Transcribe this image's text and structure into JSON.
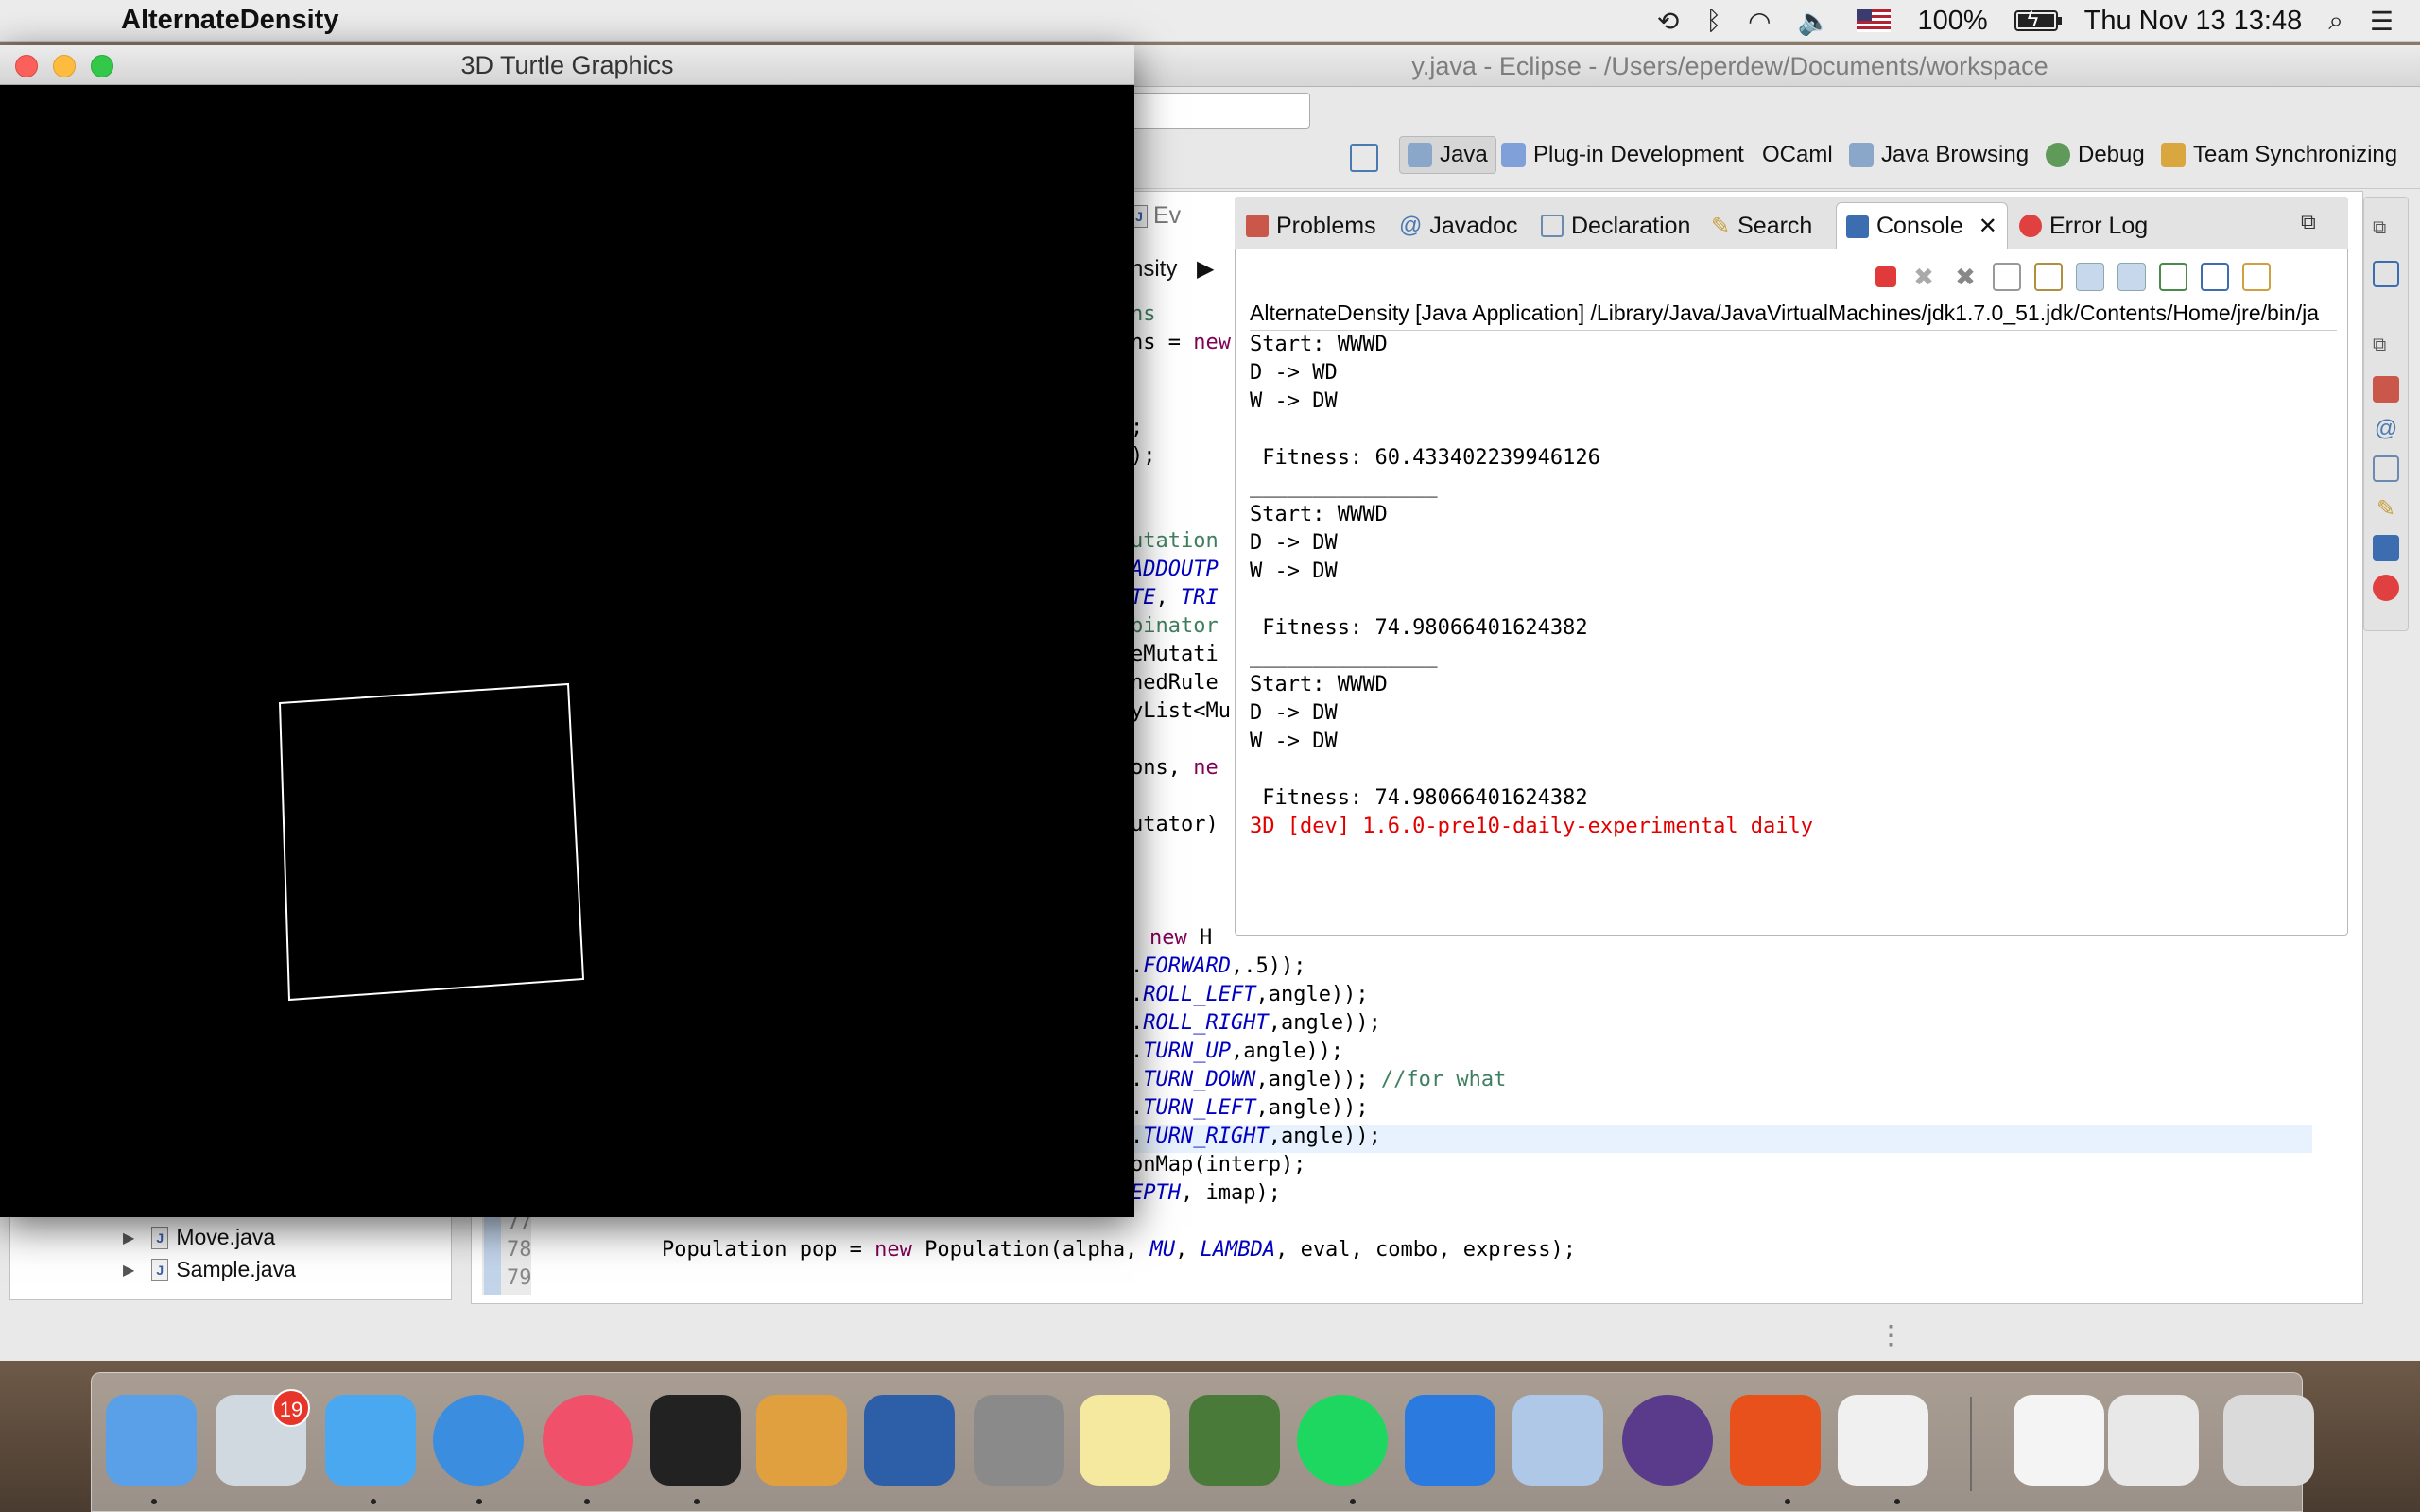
{
  "menubar": {
    "apple_glyph": "",
    "app_name": "AlternateDensity",
    "battery_pct": "100%",
    "battery_level": 1.0,
    "clock": "Thu Nov 13  13:48"
  },
  "eclipse": {
    "title": "y.java - Eclipse - /Users/eperdew/Documents/workspace",
    "perspectives": [
      "Java",
      "Plug-in Development",
      "OCaml",
      "Java Browsing",
      "Debug",
      "Team Synchronizing"
    ],
    "editor_tab_fragment": "Ev",
    "breadcrumb_fragment": "nsity",
    "code": {
      "l1": "ns",
      "l2": "ns = ",
      "l2_kw": "new",
      "l3": ";",
      "l4": ");",
      "l5": "utation",
      "l6": "ADDOUTP",
      "l7a": "TE",
      "l7b": ", ",
      "l7c": "TRI",
      "l8": "binator",
      "l9": "eMutati",
      "l10": "nedRule",
      "l11": "yList<Mu",
      "l12": "ons, ",
      "l12_kw": "ne",
      "l13": "utator)",
      "l14_kw": "new",
      "l14": " H",
      "l15a": ".",
      "l15b": "FORWARD",
      "l15c": ",.5));",
      "l16b": "ROLL_LEFT",
      "l16c": ",angle));",
      "l17b": "ROLL_RIGHT",
      "l17c": ",angle));",
      "l18b": "TURN_UP",
      "l18c": ",angle));",
      "l19b": "TURN_DOWN",
      "l19c": ",angle)); ",
      "l19d": "//for what",
      "l20b": "TURN_LEFT",
      "l20c": ",angle));",
      "l21b": "TURN_RIGHT",
      "l21c": ",angle));",
      "l22": "onMap(interp);",
      "l23b": "EPTH",
      "l23c": ", imap);",
      "l24a": "Population pop = ",
      "l24_kw": "new",
      "l24b": " Population(alpha, ",
      "l24_mu": "MU",
      "l24c": ", ",
      "l24_lambda": "LAMBDA",
      "l24d": ", eval, combo, express);",
      "line_numbers": [
        "77",
        "78",
        "79"
      ]
    },
    "package_explorer": {
      "items": [
        "Move.java",
        "Sample.java"
      ]
    },
    "views": {
      "tabs": [
        "Problems",
        "Javadoc",
        "Declaration",
        "Search",
        "Console",
        "Error Log"
      ],
      "active_tab": "Console"
    },
    "console": {
      "header": "AlternateDensity [Java Application] /Library/Java/JavaVirtualMachines/jdk1.7.0_51.jdk/Contents/Home/jre/bin/ja",
      "lines": [
        "Start: WWWD",
        "D -> WD",
        "W -> DW",
        "",
        " Fitness: 60.433402239946126",
        "_______________",
        "Start: WWWD",
        "D -> DW",
        "W -> DW",
        "",
        " Fitness: 74.98066401624382",
        "_______________",
        "Start: WWWD",
        "D -> DW",
        "W -> DW",
        "",
        " Fitness: 74.98066401624382"
      ],
      "error_line": "3D [dev] 1.6.0-pre10-daily-experimental daily"
    }
  },
  "turtle_window": {
    "title": "3D Turtle Graphics"
  },
  "dock": {
    "mail_badge": "19",
    "apps": [
      "finder",
      "mail",
      "messages",
      "safari",
      "itunes",
      "terminal",
      "gnu-icon",
      "virtualbox",
      "system-preferences",
      "notes",
      "cauldron-icon",
      "spotify",
      "xcode",
      "preview",
      "eclipse",
      "powerpoint",
      "java",
      "zip",
      "window-thumbnail",
      "trash"
    ],
    "colors": {
      "red_button": "#fc605b",
      "yellow_button": "#fdbc40",
      "green_button": "#34c84a"
    }
  }
}
